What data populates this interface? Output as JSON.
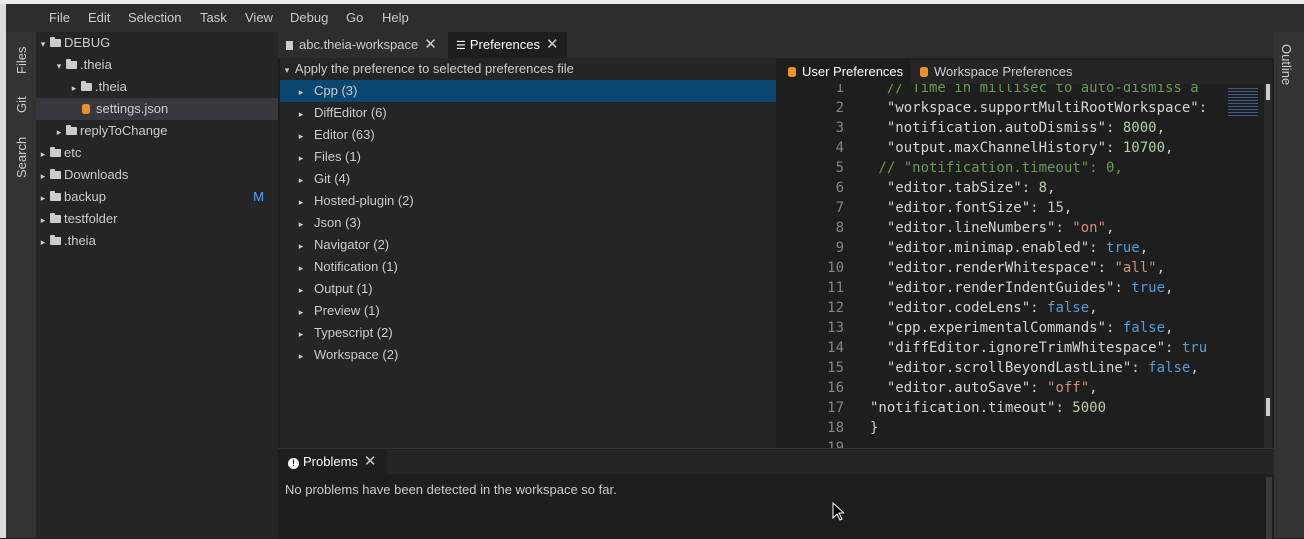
{
  "menu": [
    "File",
    "Edit",
    "Selection",
    "Task",
    "View",
    "Debug",
    "Go",
    "Help"
  ],
  "activity": {
    "files": "Files",
    "git": "Git",
    "search": "Search"
  },
  "outline_label": "Outline",
  "explorer": {
    "root": "DEBUG",
    "items": [
      {
        "label": ".theia",
        "caret": "▾",
        "kind": "folder"
      },
      {
        "label": ".theia",
        "caret": "▸",
        "kind": "folder"
      },
      {
        "label": "settings.json",
        "caret": "",
        "kind": "file"
      },
      {
        "label": "replyToChange",
        "caret": "▸",
        "kind": "folder"
      },
      {
        "label": "etc",
        "caret": "▸",
        "kind": "folder"
      },
      {
        "label": "Downloads",
        "caret": "▸",
        "kind": "folder"
      },
      {
        "label": "backup",
        "caret": "▸",
        "kind": "folder",
        "badge": "M"
      },
      {
        "label": "testfolder",
        "caret": "▸",
        "kind": "folder"
      },
      {
        "label": ".theia",
        "caret": "▸",
        "kind": "folder"
      }
    ]
  },
  "tabs": [
    {
      "label": "abc.theia-workspace",
      "icon": "file-icon"
    },
    {
      "label": "Preferences",
      "icon": "sliders-icon"
    }
  ],
  "prefs": {
    "header": "Apply the preference to selected preferences file",
    "categories": [
      "Cpp (3)",
      "DiffEditor (6)",
      "Editor (63)",
      "Files (1)",
      "Git (4)",
      "Hosted-plugin (2)",
      "Json (3)",
      "Navigator (2)",
      "Notification (1)",
      "Output (1)",
      "Preview (1)",
      "Typescript (2)",
      "Workspace (2)"
    ],
    "selected_index": 0
  },
  "pref_tabs": [
    "User Preferences",
    "Workspace Preferences"
  ],
  "code_lines": [
    {
      "n": "1",
      "t": "  // Time in millisec to auto-dismiss a",
      "cls": "c"
    },
    {
      "n": "2",
      "t": "  \"workspace.supportMultiRootWorkspace\":",
      "cls": "s"
    },
    {
      "n": "3",
      "t": "  \"notification.autoDismiss\": 8000,",
      "cls": "mix"
    },
    {
      "n": "4",
      "t": "  \"output.maxChannelHistory\": 10700,",
      "cls": "mix"
    },
    {
      "n": "5",
      "t": " // \"notification.timeout\": 0,",
      "cls": "c"
    },
    {
      "n": "6",
      "t": "  \"editor.tabSize\": 8,",
      "cls": "mix"
    },
    {
      "n": "7",
      "t": "  \"editor.fontSize\": 15,",
      "cls": "mix"
    },
    {
      "n": "8",
      "t": "  \"editor.lineNumbers\": \"on\",",
      "cls": "mix"
    },
    {
      "n": "9",
      "t": "  \"editor.minimap.enabled\": true,",
      "cls": "mix"
    },
    {
      "n": "10",
      "t": "  \"editor.renderWhitespace\": \"all\",",
      "cls": "mix"
    },
    {
      "n": "11",
      "t": "  \"editor.renderIndentGuides\": true,",
      "cls": "mix"
    },
    {
      "n": "12",
      "t": "  \"editor.codeLens\": false,",
      "cls": "mix"
    },
    {
      "n": "13",
      "t": "  \"cpp.experimentalCommands\": false,",
      "cls": "mix"
    },
    {
      "n": "14",
      "t": "  \"diffEditor.ignoreTrimWhitespace\": tru",
      "cls": "mix"
    },
    {
      "n": "15",
      "t": "  \"editor.scrollBeyondLastLine\": false,",
      "cls": "mix"
    },
    {
      "n": "16",
      "t": "  \"editor.autoSave\": \"off\",",
      "cls": "mix"
    },
    {
      "n": "17",
      "t": "\"notification.timeout\": 5000",
      "cls": "mix"
    },
    {
      "n": "18",
      "t": "}",
      "cls": "p"
    },
    {
      "n": "19",
      "t": "",
      "cls": "p"
    }
  ],
  "problems": {
    "title": "Problems",
    "message": "No problems have been detected in the workspace so far."
  },
  "colors": {
    "accent": "#094771",
    "selection": "#37373d",
    "json_icon": "#e8912d",
    "badge": "#4aa3ff"
  }
}
